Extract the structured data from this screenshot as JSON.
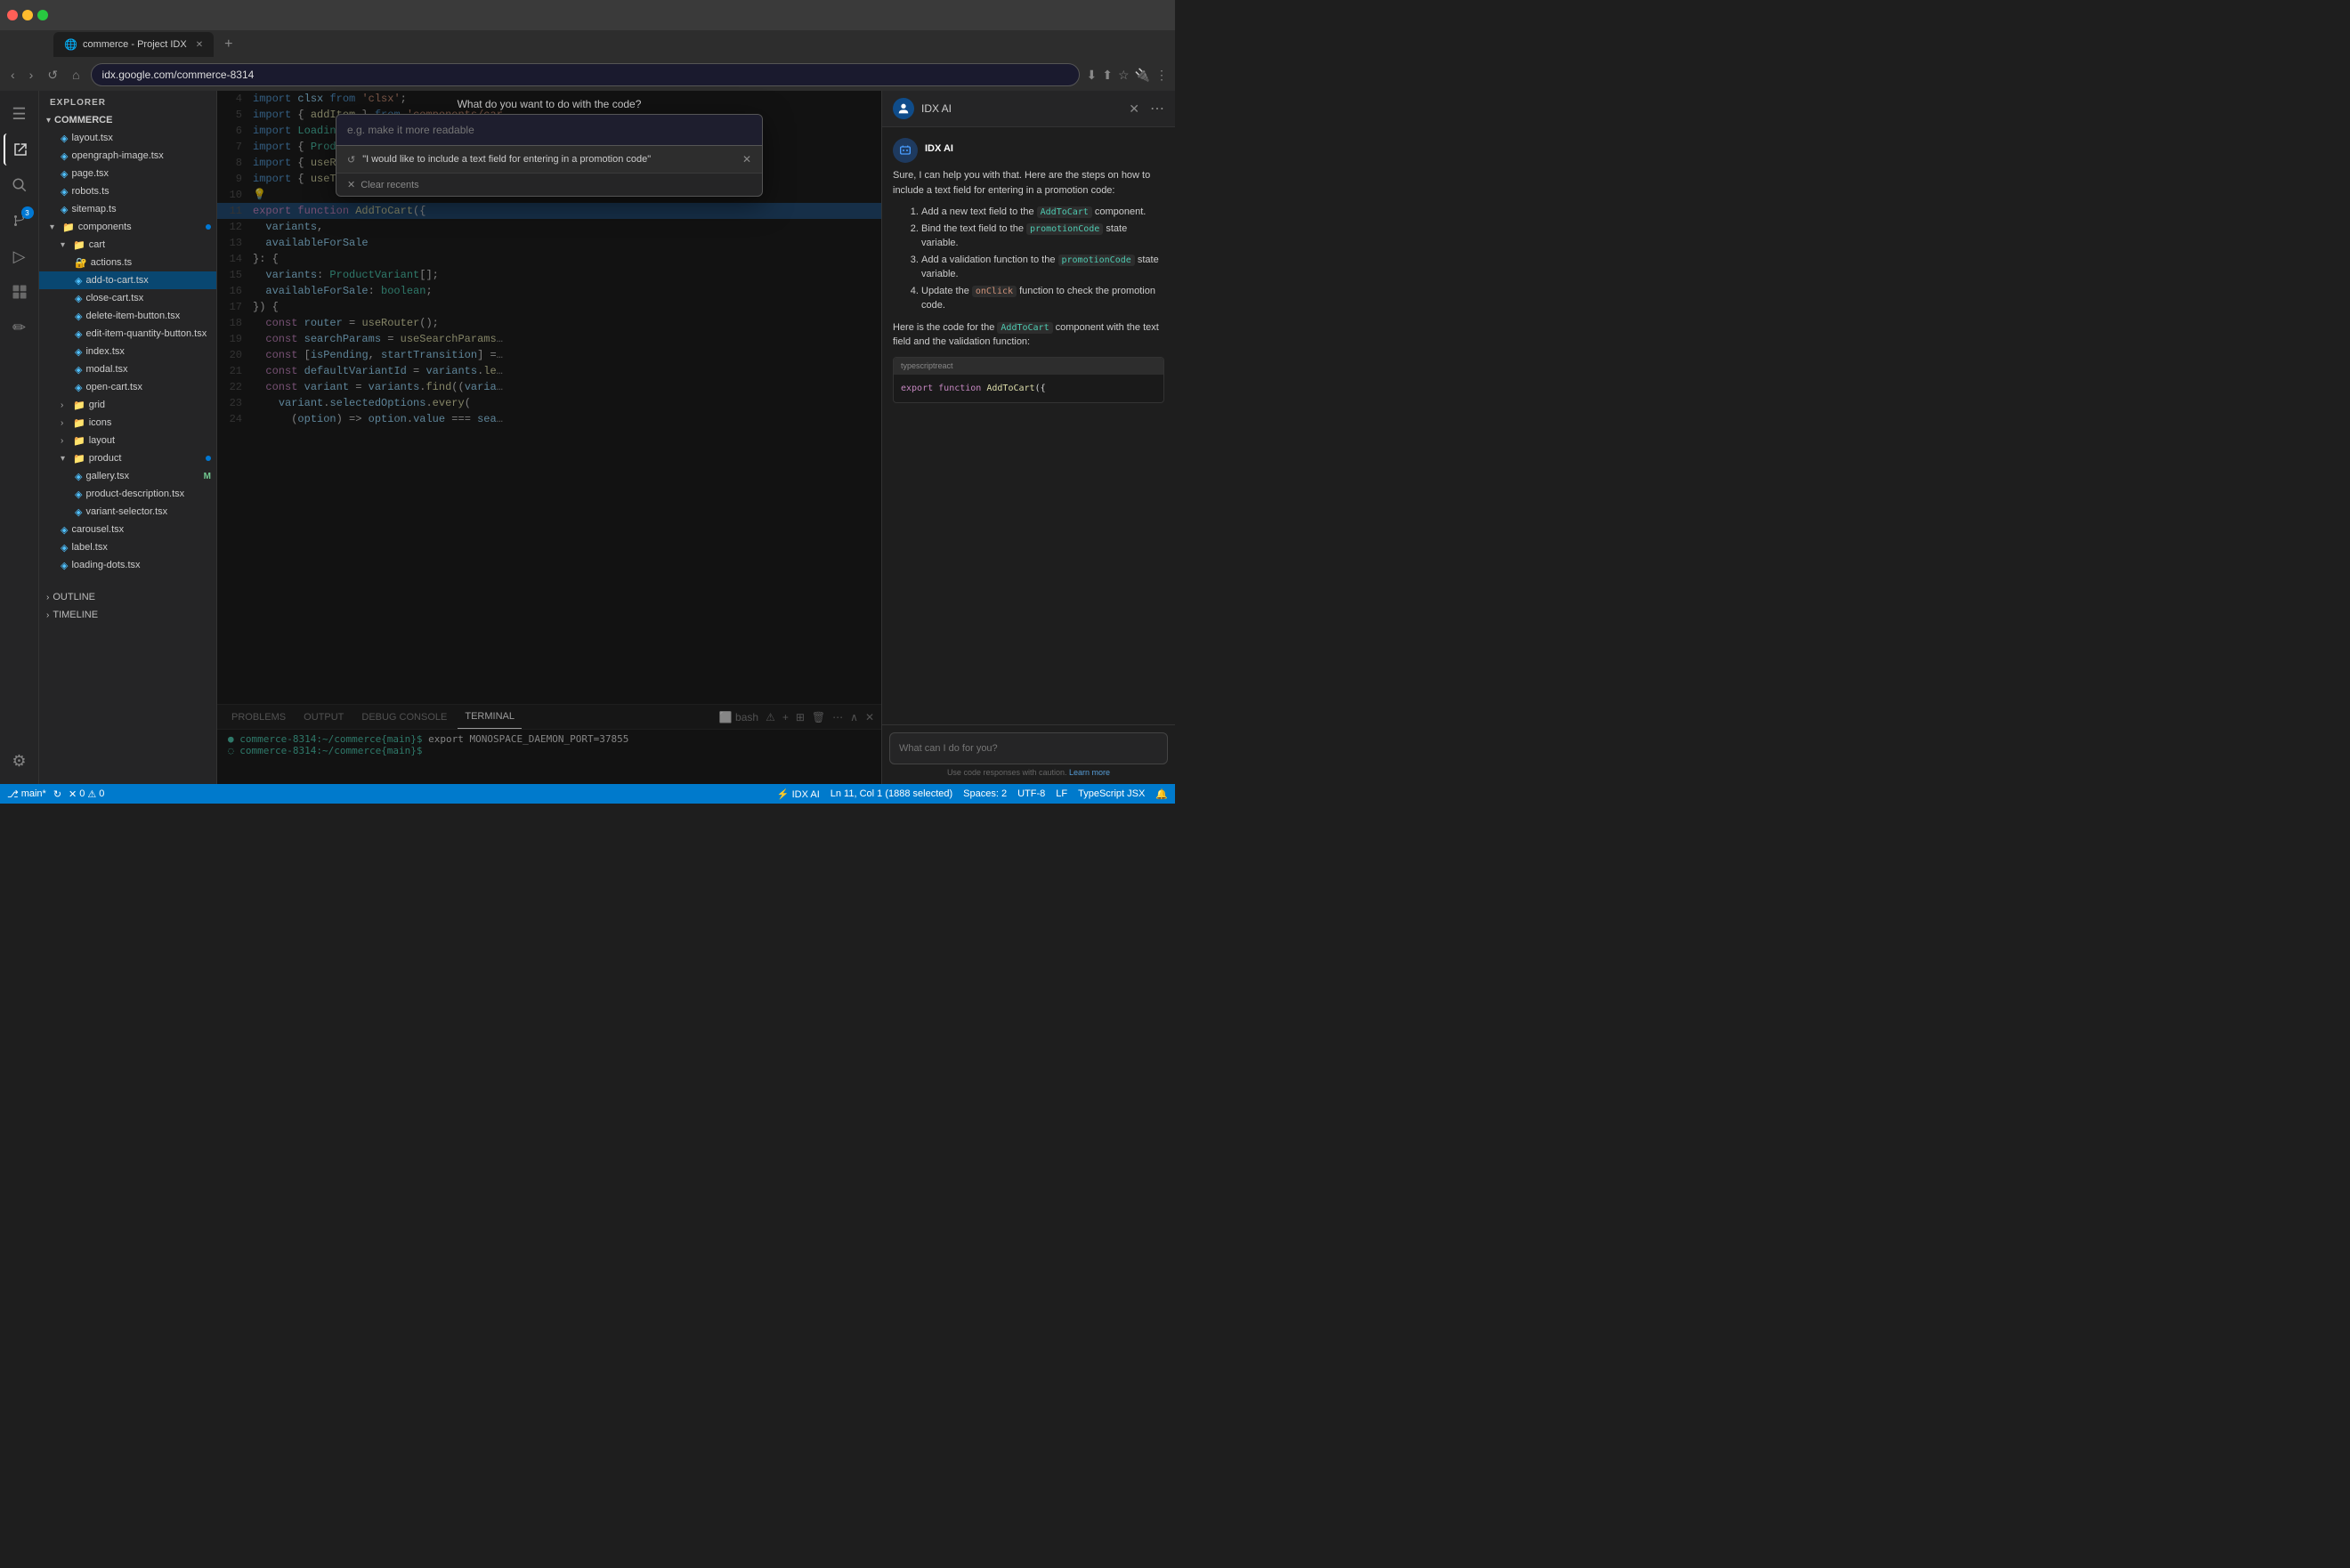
{
  "browser": {
    "tab_title": "commerce - Project IDX",
    "tab_icon": "🌐",
    "address": "idx.google.com/commerce-8314",
    "new_tab_label": "+"
  },
  "activity_bar": {
    "items": [
      {
        "name": "menu",
        "icon": "☰"
      },
      {
        "name": "explorer",
        "icon": "⬡",
        "active": true
      },
      {
        "name": "search",
        "icon": "🔍"
      },
      {
        "name": "source-control",
        "icon": "⎇",
        "badge": "3"
      },
      {
        "name": "run",
        "icon": "▷"
      },
      {
        "name": "extensions",
        "icon": "⊞"
      },
      {
        "name": "custom1",
        "icon": "✏"
      }
    ],
    "bottom_items": [
      {
        "name": "settings",
        "icon": "⚙"
      }
    ]
  },
  "sidebar": {
    "header": "EXPLORER",
    "project_name": "COMMERCE",
    "files": [
      {
        "name": "layout.tsx",
        "type": "tsx",
        "indent": 1
      },
      {
        "name": "opengraph-image.tsx",
        "type": "tsx",
        "indent": 1
      },
      {
        "name": "page.tsx",
        "type": "tsx",
        "indent": 1
      },
      {
        "name": "robots.ts",
        "type": "ts",
        "indent": 1
      },
      {
        "name": "sitemap.ts",
        "type": "ts",
        "indent": 1
      },
      {
        "name": "components",
        "type": "folder",
        "indent": 1,
        "expanded": true,
        "dot": true
      },
      {
        "name": "cart",
        "type": "folder",
        "indent": 2,
        "expanded": true
      },
      {
        "name": "actions.ts",
        "type": "ts",
        "indent": 3
      },
      {
        "name": "add-to-cart.tsx",
        "type": "tsx",
        "indent": 3,
        "selected": true
      },
      {
        "name": "close-cart.tsx",
        "type": "tsx",
        "indent": 3
      },
      {
        "name": "delete-item-button.tsx",
        "type": "tsx",
        "indent": 3
      },
      {
        "name": "edit-item-quantity-button.tsx",
        "type": "tsx",
        "indent": 3
      },
      {
        "name": "index.tsx",
        "type": "tsx",
        "indent": 3
      },
      {
        "name": "modal.tsx",
        "type": "tsx",
        "indent": 3
      },
      {
        "name": "open-cart.tsx",
        "type": "tsx",
        "indent": 3
      },
      {
        "name": "grid",
        "type": "folder",
        "indent": 2
      },
      {
        "name": "icons",
        "type": "folder",
        "indent": 2
      },
      {
        "name": "layout",
        "type": "folder",
        "indent": 2
      },
      {
        "name": "product",
        "type": "folder",
        "indent": 2,
        "expanded": true,
        "dot": true
      },
      {
        "name": "gallery.tsx",
        "type": "tsx",
        "indent": 3,
        "mod": "M"
      },
      {
        "name": "product-description.tsx",
        "type": "tsx",
        "indent": 3
      },
      {
        "name": "variant-selector.tsx",
        "type": "tsx",
        "indent": 3
      },
      {
        "name": "carousel.tsx",
        "type": "tsx",
        "indent": 2
      },
      {
        "name": "label.tsx",
        "type": "tsx",
        "indent": 2
      },
      {
        "name": "loading-dots.tsx",
        "type": "tsx",
        "indent": 2
      }
    ],
    "outline_label": "OUTLINE",
    "timeline_label": "TIMELINE"
  },
  "modal": {
    "title": "What do you want to do with the code?",
    "input_placeholder": "e.g. make it more readable",
    "suggestion_icon": "↺",
    "suggestion_text": "\"I would like to include a text field for entering in a promotion code\"",
    "clear_recents_label": "Clear recents"
  },
  "code_editor": {
    "lines": [
      {
        "num": 4,
        "content": "import clsx from 'clsx';",
        "tokens": [
          {
            "text": "import ",
            "cls": "kw2"
          },
          {
            "text": "clsx ",
            "cls": "var"
          },
          {
            "text": "from ",
            "cls": "kw2"
          },
          {
            "text": "'clsx'",
            "cls": "str"
          },
          {
            "text": ";",
            "cls": "op"
          }
        ]
      },
      {
        "num": 5,
        "content": "import { addItem } from 'components/car",
        "truncated": true
      },
      {
        "num": 6,
        "content": "import LoadingDots from 'components/loa",
        "truncated": true
      },
      {
        "num": 7,
        "content": "import { ProductVariant } from 'lib/sho",
        "truncated": true
      },
      {
        "num": 8,
        "content": "import { useRouter, useSearchParams } f",
        "truncated": true
      },
      {
        "num": 9,
        "content": "import { useTransition } from 'react';"
      },
      {
        "num": 10,
        "content": ""
      },
      {
        "num": 11,
        "content": "export function AddToCart({",
        "highlighted": true
      },
      {
        "num": 12,
        "content": "  variants,"
      },
      {
        "num": 13,
        "content": "  availableForSale"
      },
      {
        "num": 14,
        "content": "}: {"
      },
      {
        "num": 15,
        "content": "  variants: ProductVariant[];"
      },
      {
        "num": 16,
        "content": "  availableForSale: boolean;"
      },
      {
        "num": 17,
        "content": "}) {"
      },
      {
        "num": 18,
        "content": "  const router = useRouter();"
      },
      {
        "num": 19,
        "content": "  const searchParams = useSearchParams("
      },
      {
        "num": 20,
        "content": "  const [isPending, startTransition] ="
      },
      {
        "num": 21,
        "content": "  const defaultVariantId = variants.le"
      },
      {
        "num": 22,
        "content": "  const variant = variants.find((varia"
      },
      {
        "num": 23,
        "content": "    variant.selectedOptions.every("
      },
      {
        "num": 24,
        "content": "      (option) => option.value === sea"
      }
    ]
  },
  "ai_panel": {
    "title": "IDX AI",
    "avatar_text": "AI",
    "message_author": "IDX AI",
    "message_intro": "Sure, I can help you with that. Here are the steps on how to include a text field for entering in a promotion code:",
    "steps": [
      "Add a new text field to the AddToCart component.",
      "Bind the text field to the promotionCode state variable.",
      "Add a validation function to the promotionCode state variable.",
      "Update the onClick function to check the promotion code."
    ],
    "message_outro_1": "Here is the code for the",
    "add_to_cart_ref": "AddToCart",
    "message_outro_2": "component with the text field and the validation function:",
    "code_lang": "typescriptreact",
    "code_snippet": "export function AddToCart({",
    "input_placeholder": "What can I do for you?",
    "caution_text": "Use code responses with caution.",
    "learn_more_label": "Learn more"
  },
  "terminal": {
    "tabs": [
      "PROBLEMS",
      "OUTPUT",
      "DEBUG CONSOLE",
      "TERMINAL"
    ],
    "active_tab": "TERMINAL",
    "shell_type": "bash",
    "lines": [
      {
        "prompt": "commerce-8314:~/commerce{main}$",
        "cmd": " export MONOSPACE_DAEMON_PORT=37855"
      },
      {
        "prompt": "commerce-8314:~/commerce{main}$",
        "cmd": ""
      }
    ]
  },
  "status_bar": {
    "branch": "main*",
    "sync_icon": "↻",
    "errors": "0",
    "warnings": "0",
    "ai_label": "⚡ IDX AI",
    "position": "Ln 11, Col 1 (1888 selected)",
    "spaces": "Spaces: 2",
    "encoding": "UTF-8",
    "line_ending": "LF",
    "language": "TypeScript JSX",
    "notification_icon": "🔔"
  }
}
